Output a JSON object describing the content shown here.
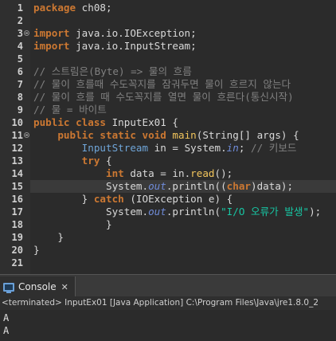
{
  "editor": {
    "line_numbers": [
      "1",
      "2",
      "3",
      "4",
      "5",
      "6",
      "7",
      "8",
      "9",
      "10",
      "11",
      "12",
      "13",
      "14",
      "15",
      "16",
      "17",
      "18",
      "19",
      "20",
      "21"
    ],
    "lines": {
      "l1": {
        "kw": "package",
        "rest": " ch08;"
      },
      "l3": {
        "kw": "import",
        "rest": " java.io.IOException;"
      },
      "l4": {
        "kw": "import",
        "rest": " java.io.InputStream;"
      },
      "l6": "// 스트림은(Byte) => 물의 흐름",
      "l7": "// 물이 흐를때 수도꼭지를 잠궈두면 물이 흐르지 않는다",
      "l8": "// 물이 흐를 때 수도꼭지를 열면 물이 흐른다(통신시작)",
      "l9": "// 물 = 바이트",
      "l10": {
        "kw": "public class",
        "rest": " InputEx01 {"
      },
      "l11": {
        "indent": "    ",
        "kw": "public static void",
        "method": " main",
        "p1": "(String[] ",
        "arg": "args",
        "p2": ") {"
      },
      "l12": {
        "indent": "        ",
        "type": "InputStream",
        "v1": " in = System.",
        "field": "in",
        "v2": "; ",
        "comment": "// 키보드"
      },
      "l13": {
        "indent": "        ",
        "kw": "try",
        "rest": " {"
      },
      "l14": {
        "indent": "            ",
        "kw": "int",
        "v1": " data = in.",
        "method": "read",
        "v2": "();"
      },
      "l15": {
        "indent": "            ",
        "v1": "System.",
        "field": "out",
        "v2": ".println((",
        "kw": "char",
        "v3": ")data);"
      },
      "l16": {
        "indent": "        ",
        "v1": "} ",
        "kw": "catch",
        "v2": " (IOException e) {"
      },
      "l17": {
        "indent": "            ",
        "v1": "System.",
        "field": "out",
        "v2": ".println(",
        "str": "\"I/O 오류가 발생\"",
        "v3": ");"
      },
      "l18": "            }",
      "l19": "    }",
      "l20": "}"
    }
  },
  "console": {
    "tab_label": "Console",
    "close_glyph": "✕",
    "status": "<terminated> InputEx01 [Java Application] C:\\Program Files\\Java\\jre1.8.0_2",
    "output": [
      "A",
      "A"
    ]
  },
  "colors": {
    "keyword": "#cc7832",
    "comment": "#808080",
    "string": "#17c6a3",
    "method": "#f2c55c",
    "field": "#6f8bd8",
    "type": "#6fa5d8",
    "editor_bg": "#2b2b2b"
  }
}
